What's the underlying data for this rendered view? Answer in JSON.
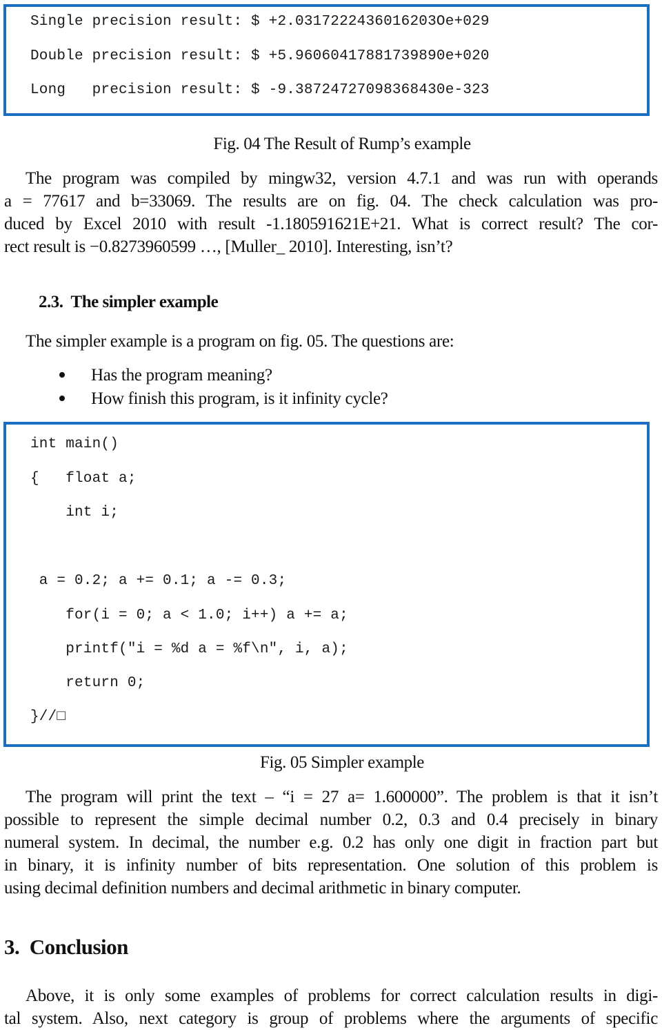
{
  "fig04": {
    "lines": [
      "Single precision result: $ +2.0317222436016203Oe+029",
      "Double precision result: $ +5.96060417881739890e+020",
      "Long   precision result: $ -9.38724727098368430e-323"
    ],
    "caption": "Fig. 04 The Result of Rump’s example"
  },
  "para1": {
    "lines": [
      "The program was compiled by mingw32, version 4.7.1 and was run with operands",
      "a = 77617 and b=33069. The results are on fig. 04. The check calculation was pro-",
      "duced by Excel 2010 with result -1.180591621E+21. What is correct result? The cor-",
      "rect result is −0.8273960599 …, [Muller_ 2010]. Interesting, isn’t?"
    ]
  },
  "section23": {
    "heading": "2.3.  The simpler example",
    "intro": "The simpler example is a program on fig. 05. The questions are:",
    "bullets": [
      "Has the program meaning?",
      "How finish this program, is it infinity cycle?"
    ]
  },
  "fig05": {
    "lines": [
      "int main()",
      "{   float a;",
      "    int i;",
      " a = 0.2; a += 0.1; a -= 0.3;",
      "    for(i = 0; a < 1.0; i++) a += a;",
      "    printf(\"i = %d a = %f\\n\", i, a);",
      "    return 0;",
      "}//□"
    ],
    "caption": "Fig. 05 Simpler example"
  },
  "para2": {
    "lines": [
      "The program will print the text – “i = 27 a= 1.600000”. The problem is that it isn’t",
      "possible to represent the simple decimal number 0.2, 0.3 and 0.4 precisely in binary",
      "numeral system. In decimal, the number e.g. 0.2 has only one digit in fraction part but",
      "in binary, it is infinity number of bits representation. One solution of this problem is",
      "using decimal definition numbers and decimal arithmetic in binary computer."
    ]
  },
  "section3": {
    "heading": "3.  Conclusion",
    "lines": [
      "Above, it is only some examples of problems for correct calculation results in digi-",
      "tal system. Also, next category is group of problems where the arguments of specific"
    ]
  },
  "colors": {
    "box_border": "#1a6fc0",
    "text": "#111111"
  }
}
